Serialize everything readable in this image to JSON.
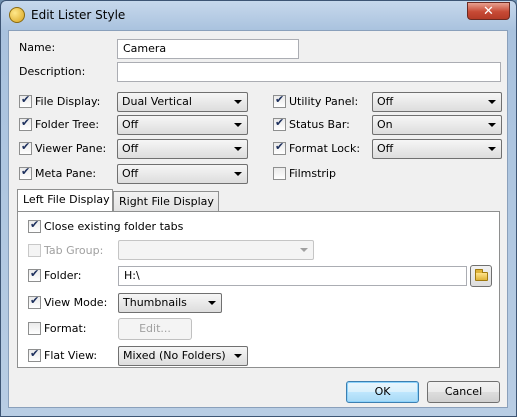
{
  "window": {
    "title": "Edit Lister Style",
    "close_glyph": "✕"
  },
  "fields": {
    "name_label": "Name:",
    "name_value": "Camera",
    "description_label": "Description:",
    "description_value": ""
  },
  "options_left": [
    {
      "label": "File Display:",
      "checked": true,
      "value": "Dual Vertical"
    },
    {
      "label": "Folder Tree:",
      "checked": true,
      "value": "Off"
    },
    {
      "label": "Viewer Pane:",
      "checked": true,
      "value": "Off"
    },
    {
      "label": "Meta Pane:",
      "checked": true,
      "value": "Off"
    }
  ],
  "options_right": [
    {
      "label": "Utility Panel:",
      "checked": true,
      "value": "Off"
    },
    {
      "label": "Status Bar:",
      "checked": true,
      "value": "On"
    },
    {
      "label": "Format Lock:",
      "checked": true,
      "value": "Off"
    },
    {
      "label": "Filmstrip",
      "checked": false
    }
  ],
  "tabs": [
    {
      "label": "Left File Display",
      "active": true
    },
    {
      "label": "Right File Display",
      "active": false
    }
  ],
  "panel": {
    "close_tabs_label": "Close existing folder tabs",
    "tab_group_label": "Tab Group:",
    "tab_group_value": "",
    "folder_label": "Folder:",
    "folder_value": "H:\\",
    "view_mode_label": "View Mode:",
    "view_mode_value": "Thumbnails",
    "format_label": "Format:",
    "format_button": "Edit...",
    "flat_view_label": "Flat View:",
    "flat_view_value": "Mixed (No Folders)"
  },
  "buttons": {
    "ok": "OK",
    "cancel": "Cancel"
  },
  "icons": {
    "app": "lister-style-icon",
    "folder": "folder-icon"
  }
}
